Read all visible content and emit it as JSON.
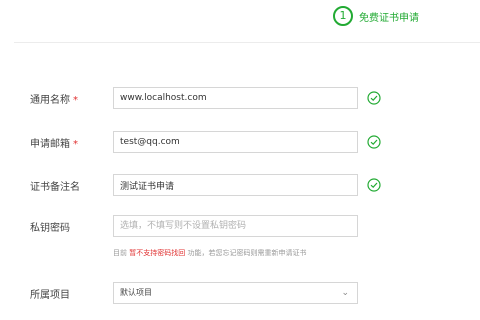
{
  "colors": {
    "accent": "#22aa33",
    "required": "#e03030"
  },
  "step": {
    "number": "1",
    "label": "免费证书申请"
  },
  "form": {
    "common_name": {
      "label": "通用名称",
      "required_mark": "*",
      "value": "www.localhost.com"
    },
    "email": {
      "label": "申请邮箱",
      "required_mark": "*",
      "value": "test@qq.com"
    },
    "remark": {
      "label": "证书备注名",
      "value": "测试证书申请"
    },
    "private_key_password": {
      "label": "私钥密码",
      "placeholder": "选填，不填写则不设置私钥密码"
    },
    "hint": {
      "prefix": "目前",
      "highlight": "暂不支持密码找回",
      "suffix": "功能，若您忘记密码则需重新申请证书"
    },
    "project": {
      "label": "所属项目",
      "value": "默认项目"
    }
  }
}
